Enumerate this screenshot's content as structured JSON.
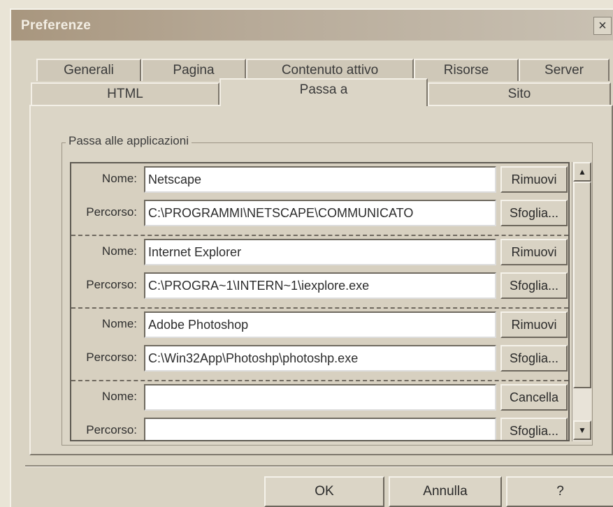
{
  "window": {
    "title": "Preferenze",
    "close_glyph": "×"
  },
  "tabs_back": [
    "Generali",
    "Pagina",
    "Contenuto attivo",
    "Risorse",
    "Server"
  ],
  "tabs_front": [
    "HTML",
    "Passa a",
    "Sito"
  ],
  "active_tab": "Passa a",
  "group": {
    "label": "Passa alle applicazioni"
  },
  "labels": {
    "name": "Nome:",
    "path": "Percorso:"
  },
  "entries": [
    {
      "name": "Netscape",
      "path": "C:\\PROGRAMMI\\NETSCAPE\\COMMUNICATO",
      "remove_label": "Rimuovi",
      "browse_label": "Sfoglia..."
    },
    {
      "name": "Internet Explorer",
      "path": "C:\\PROGRA~1\\INTERN~1\\iexplore.exe",
      "remove_label": "Rimuovi",
      "browse_label": "Sfoglia..."
    },
    {
      "name": "Adobe Photoshop",
      "path": "C:\\Win32App\\Photoshp\\photoshp.exe",
      "remove_label": "Rimuovi",
      "browse_label": "Sfoglia..."
    },
    {
      "name": "",
      "path": "",
      "remove_label": "Cancella",
      "browse_label": "Sfoglia..."
    }
  ],
  "scrollbar": {
    "up_glyph": "▲",
    "down_glyph": "▼"
  },
  "buttons": {
    "ok": "OK",
    "cancel": "Annulla",
    "help": "?"
  }
}
